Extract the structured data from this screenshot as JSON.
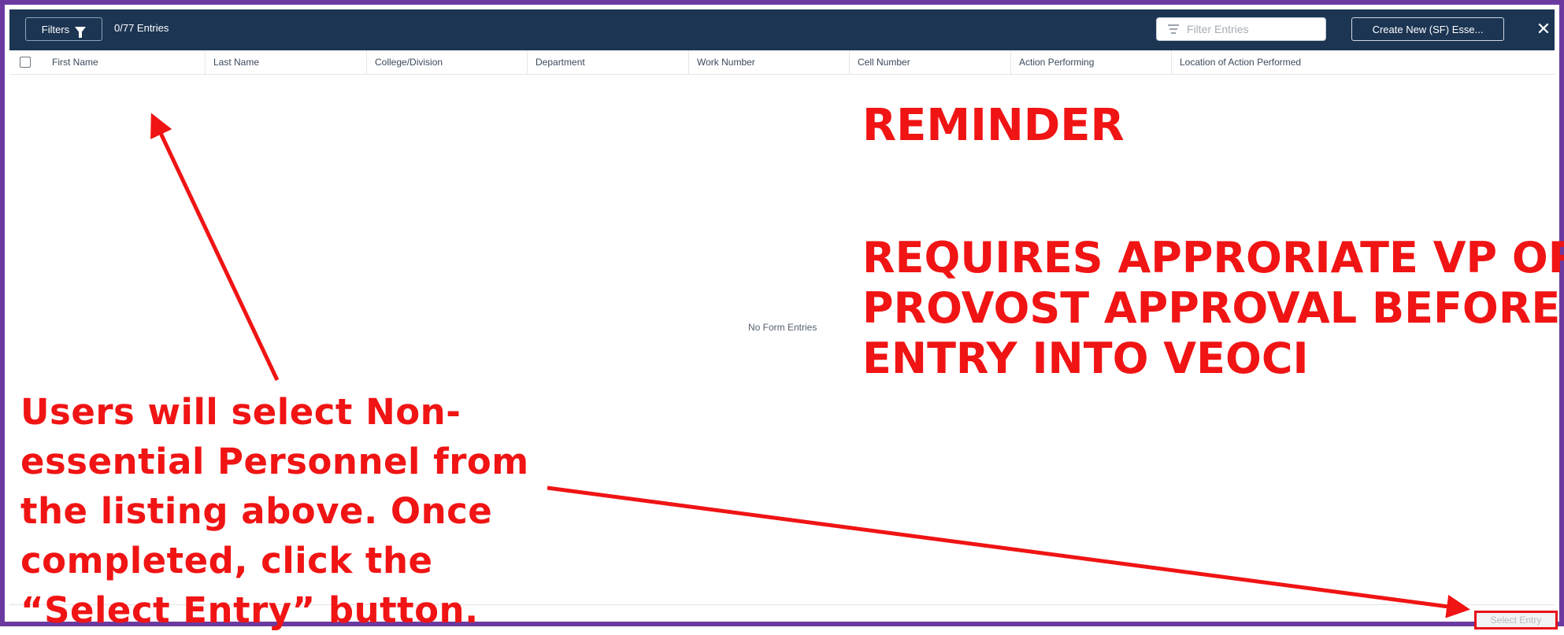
{
  "toolbar": {
    "filters_label": "Filters",
    "filters_icon": "funnel-icon",
    "entries_count": "0/77 Entries",
    "filter_placeholder": "Filter Entries",
    "filter_icon": "filter-lines-icon",
    "create_button_label": "Create New (SF) Esse...",
    "close_glyph": "✕"
  },
  "table": {
    "columns": [
      "First Name",
      "Last Name",
      "College/Division",
      "Department",
      "Work Number",
      "Cell Number",
      "Action Performing",
      "Location of Action Performed"
    ],
    "empty_message": "No Form Entries"
  },
  "footer": {
    "select_entry_label": "Select Entry"
  },
  "annotations": {
    "reminder": "REMINDER",
    "approval_lines": [
      "REQUIRES APPRORIATE VP OR",
      "PROVOST APPROVAL BEFORE",
      "ENTRY INTO VEOCI"
    ],
    "instruction_lines": [
      "Users will select Non-",
      "essential Personnel from",
      "the listing above. Once",
      "completed, click the",
      "“Select Entry” button."
    ],
    "color": "#f01414"
  },
  "colors": {
    "frame_border": "#6a3aa0",
    "topbar_bg": "#1c3553",
    "highlight_red": "#e8101a"
  }
}
